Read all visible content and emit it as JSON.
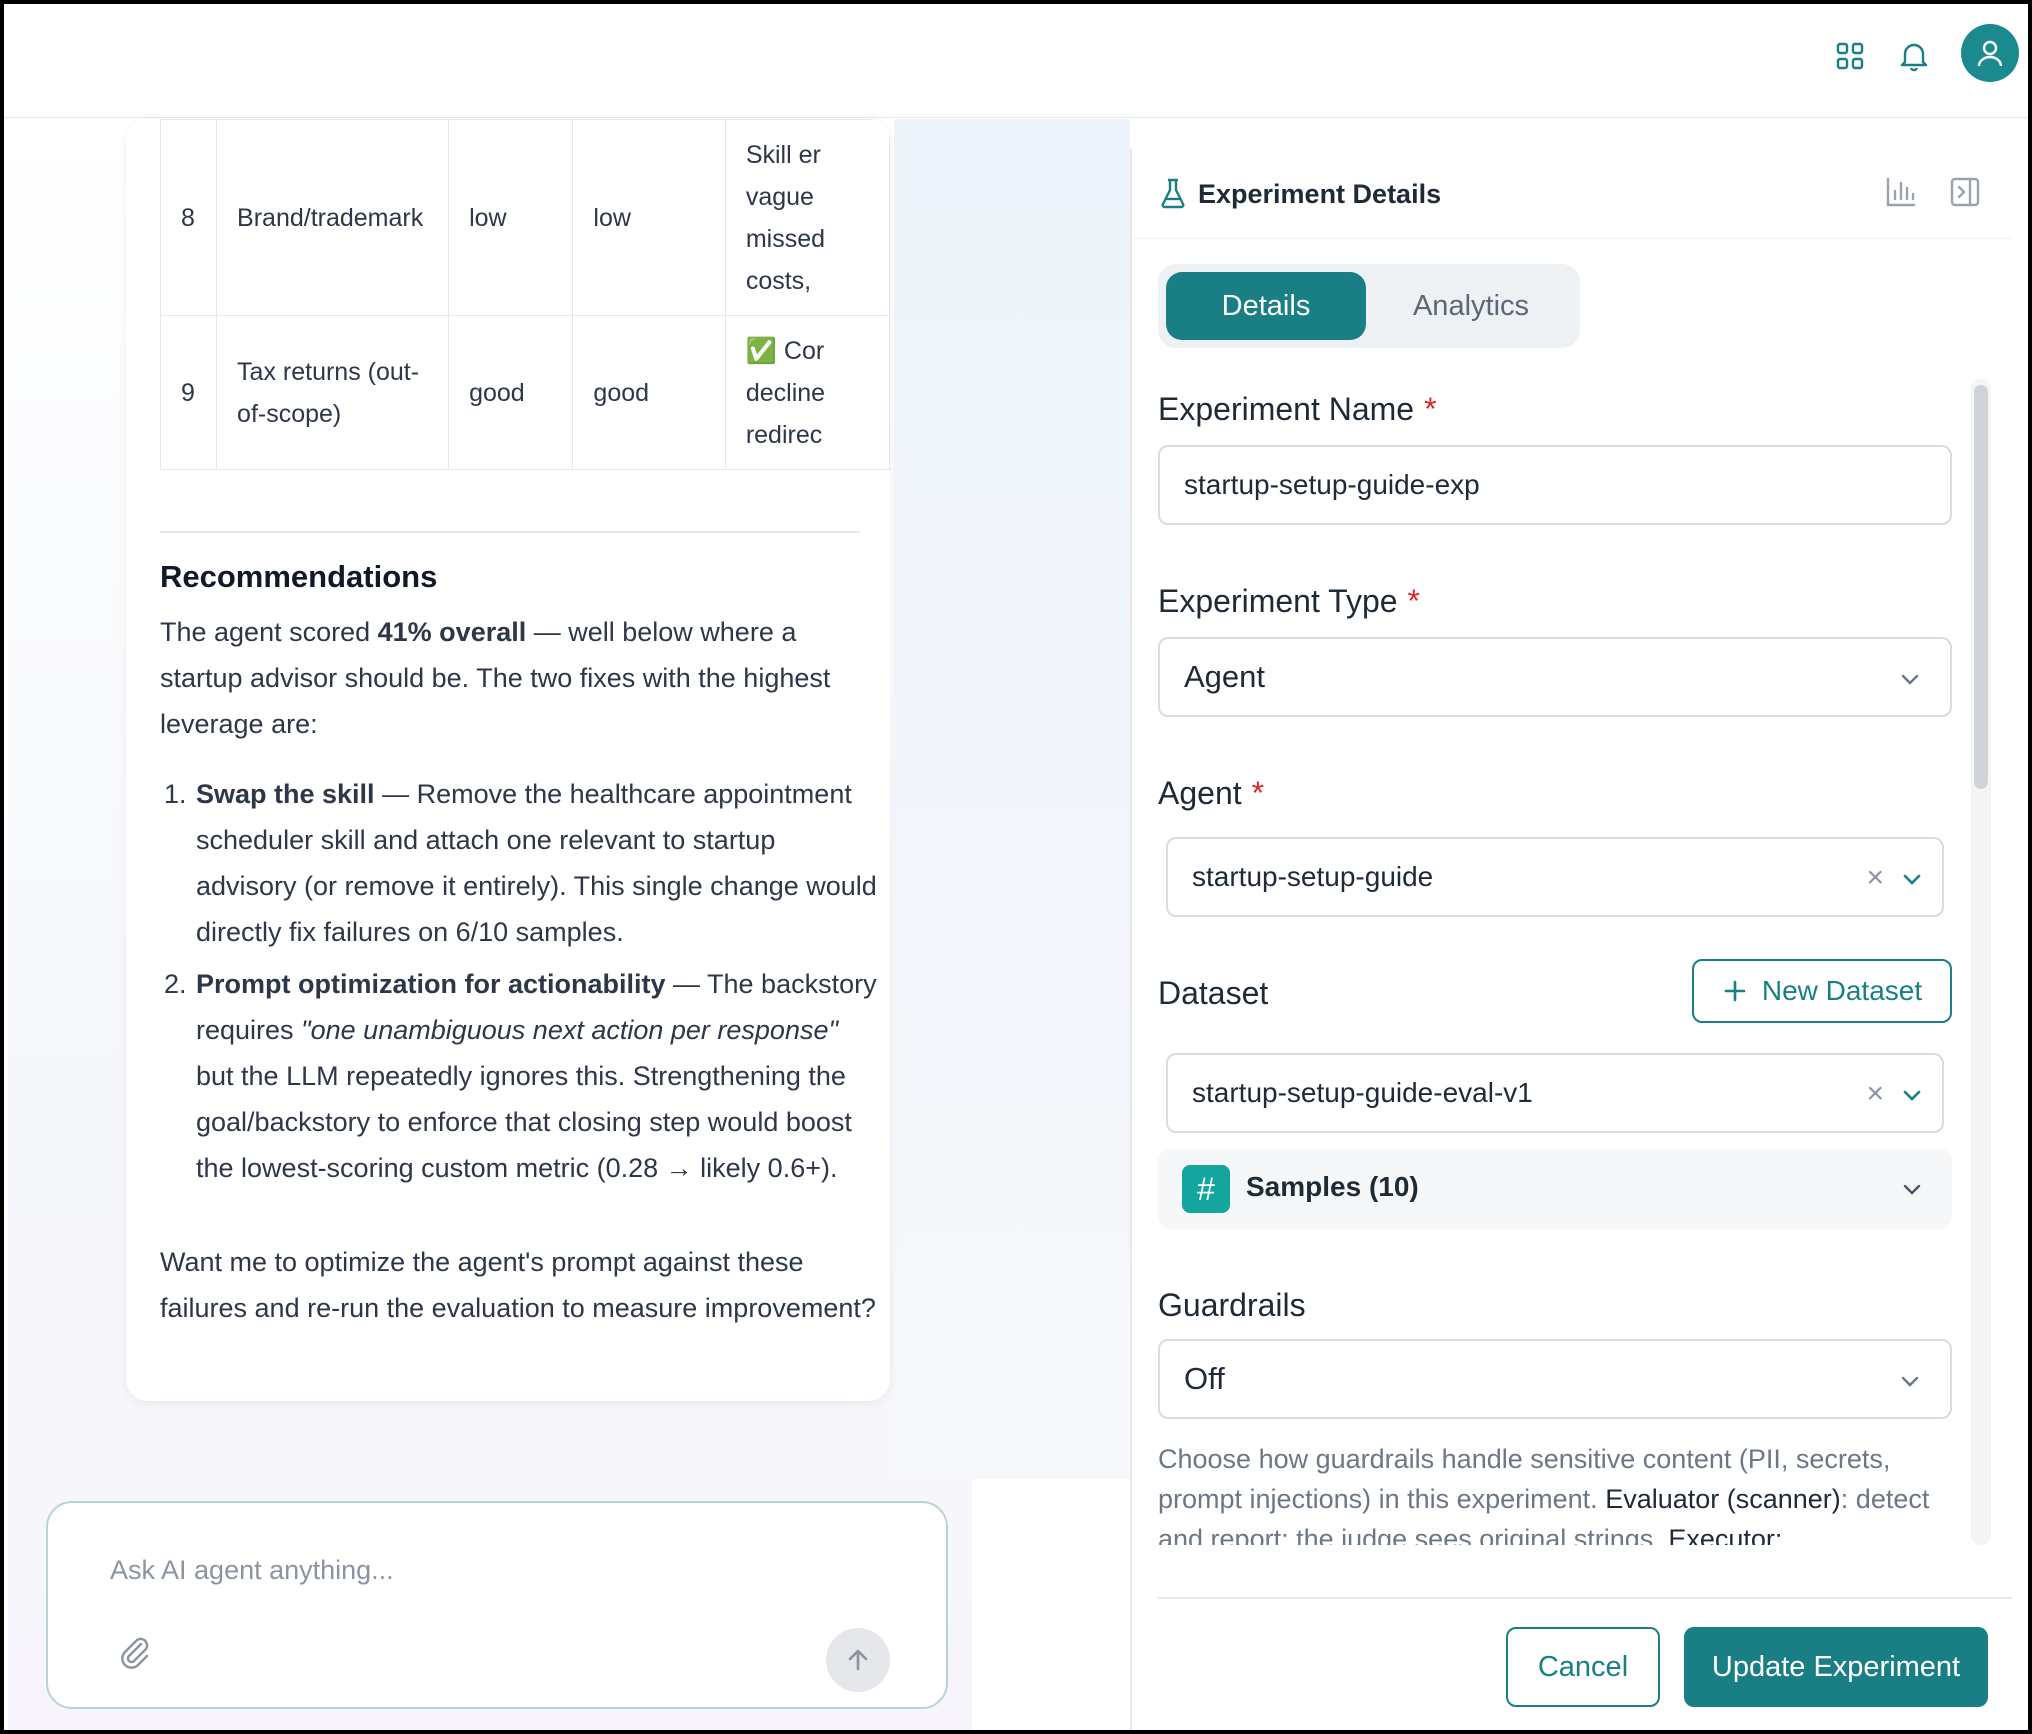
{
  "topbar": {
    "icons": [
      "grid-icon",
      "bell-icon",
      "user-avatar-icon"
    ],
    "accent": "#1a8a8e"
  },
  "table": {
    "rows": [
      {
        "num": "8",
        "category": "Brand/trademark",
        "before": "low",
        "after": "low",
        "notes": [
          "Skill er",
          "vague",
          "missed",
          "costs,"
        ]
      },
      {
        "num": "9",
        "category_lines": [
          "Tax returns (out-",
          "of-scope)"
        ],
        "before": "good",
        "after": "good",
        "notes": [
          "✅ Cor",
          "decline",
          "redirec"
        ]
      }
    ]
  },
  "recommendations": {
    "title": "Recommendations",
    "intro_prefix": "The agent scored ",
    "intro_bold": "41% overall",
    "intro_suffix": " — well below where a startup advisor should be. The two fixes with the highest leverage are:",
    "items": [
      {
        "num": "1.",
        "bold": "Swap the skill",
        "text": " — Remove the healthcare appointment scheduler skill and attach one relevant to startup advisory (or remove it entirely). This single change would directly fix failures on 6/10 samples."
      },
      {
        "num": "2.",
        "bold": "Prompt optimization for actionability",
        "text_a": " — The backstory requires ",
        "italic": "\"one unambiguous next action per response\"",
        "text_b": " but the LLM repeatedly ignores this. Strengthening the goal/backstory to enforce that closing step would boost the lowest-scoring custom metric (0.28 → likely 0.6+)."
      }
    ],
    "closing": "Want me to optimize the agent's prompt against these failures and re-run the evaluation to measure improvement?"
  },
  "chat_input": {
    "placeholder": "Ask AI agent anything..."
  },
  "panel": {
    "title": "Experiment Details",
    "tabs": [
      {
        "label": "Details",
        "active": true
      },
      {
        "label": "Analytics",
        "active": false
      }
    ],
    "fields": {
      "experiment_name_label": "Experiment Name",
      "experiment_name_value": "startup-setup-guide-exp",
      "experiment_type_label": "Experiment Type",
      "experiment_type_value": "Agent",
      "agent_label": "Agent",
      "agent_value": "startup-setup-guide",
      "dataset_label": "Dataset",
      "new_dataset_label": "New Dataset",
      "dataset_value": "startup-setup-guide-eval-v1",
      "samples_label": "Samples (10)",
      "samples_badge": "#",
      "guardrails_label": "Guardrails",
      "guardrails_value": "Off",
      "required_mark": "*"
    },
    "guardrails_help": {
      "part1": "Choose how guardrails handle sensitive content (PII, secrets, prompt injections) in this experiment. ",
      "evaluator_label": "Evaluator (scanner)",
      "part2": ": detect and report; the judge sees original strings. ",
      "executor_label": "Executor:"
    },
    "buttons": {
      "cancel": "Cancel",
      "update": "Update Experiment"
    },
    "accent": "#1a7f84"
  }
}
